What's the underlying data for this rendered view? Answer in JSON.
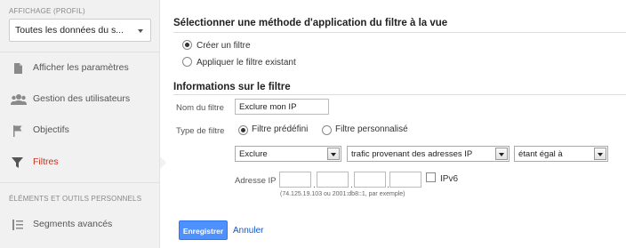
{
  "sidebar": {
    "view_section_title": "AFFICHAGE (PROFIL)",
    "profile_selected": "Toutes les données du s...",
    "items": [
      {
        "label": "Afficher les paramètres",
        "icon": "page-icon"
      },
      {
        "label": "Gestion des utilisateurs",
        "icon": "users-icon"
      },
      {
        "label": "Objectifs",
        "icon": "flag-icon"
      },
      {
        "label": "Filtres",
        "icon": "filter-icon",
        "active": true
      }
    ],
    "personal_section_title": "ÉLÉMENTS ET OUTILS PERSONNELS",
    "personal_items": [
      {
        "label": "Segments avancés",
        "icon": "segments-icon"
      }
    ]
  },
  "method": {
    "title": "Sélectionner une méthode d'application du filtre à la vue",
    "options": [
      {
        "label": "Créer un filtre",
        "checked": true
      },
      {
        "label": "Appliquer le filtre existant",
        "checked": false
      }
    ]
  },
  "info": {
    "title": "Informations sur le filtre",
    "name_label": "Nom du filtre",
    "name_value": "Exclure mon IP",
    "type_label": "Type de filtre",
    "type_options": [
      {
        "label": "Filtre prédéfini",
        "checked": true
      },
      {
        "label": "Filtre personnalisé",
        "checked": false
      }
    ],
    "selects": {
      "action": "Exclure",
      "source": "trafic provenant des adresses IP",
      "operator": "étant égal à"
    },
    "ip_label": "Adresse IP",
    "ip_values": [
      "",
      "",
      "",
      ""
    ],
    "ipv6_label": "IPv6",
    "ipv6_checked": false,
    "ip_hint": "(74.125.19.103 ou 2001:db8::1, par exemple)"
  },
  "actions": {
    "save_label": "Enregistrer",
    "cancel_label": "Annuler"
  },
  "colors": {
    "primary_button": "#4d90fe",
    "active_item": "#c23321",
    "link": "#1155cc"
  }
}
